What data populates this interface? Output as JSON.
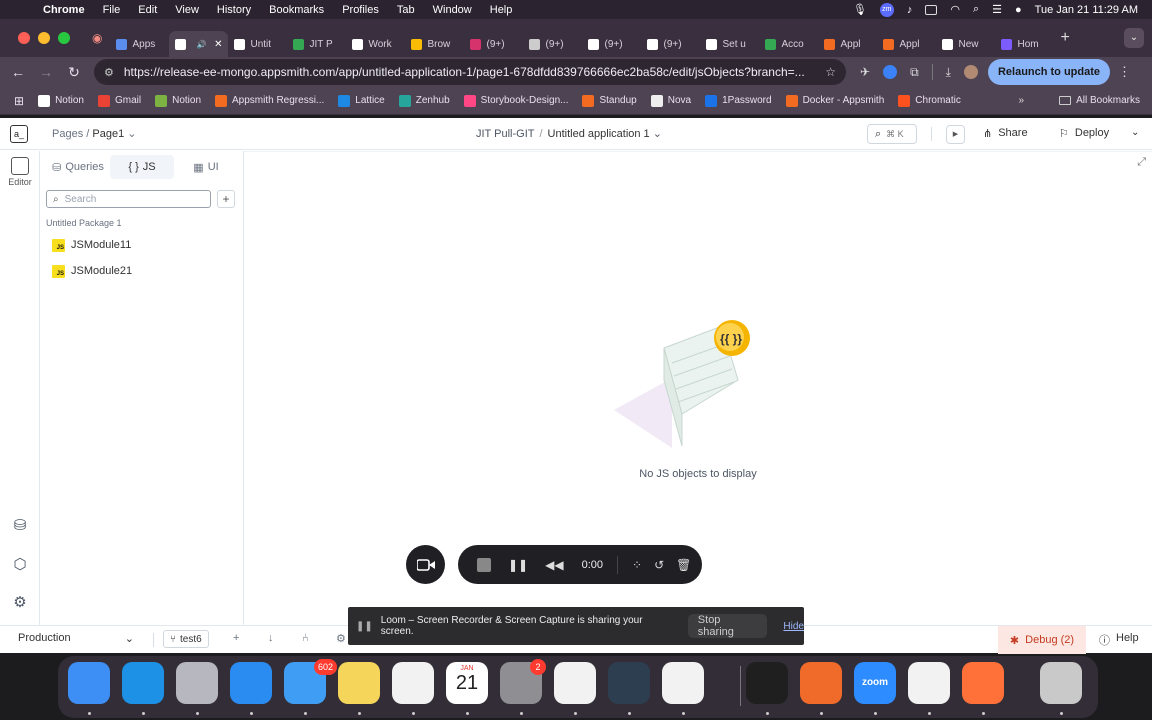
{
  "menubar": {
    "app": "Chrome",
    "items": [
      "File",
      "Edit",
      "View",
      "History",
      "Bookmarks",
      "Profiles",
      "Tab",
      "Window",
      "Help"
    ],
    "datetime": "Tue Jan 21  11:29 AM",
    "zm_label": "zm"
  },
  "tabs": [
    {
      "label": "Apps",
      "color": "#5b8def"
    },
    {
      "label": "",
      "color": "#ffffff",
      "active": true
    },
    {
      "label": "Untit",
      "color": "#ffffff"
    },
    {
      "label": "JIT P",
      "color": "#34a853"
    },
    {
      "label": "Work",
      "color": "#ffffff"
    },
    {
      "label": "Brow",
      "color": "#fbbc05"
    },
    {
      "label": "(9+)",
      "color": "#d6336c"
    },
    {
      "label": "(9+)",
      "color": "#cccccc"
    },
    {
      "label": "(9+)",
      "color": "#ffffff"
    },
    {
      "label": "(9+)",
      "color": "#ffffff"
    },
    {
      "label": "Set u",
      "color": "#ffffff"
    },
    {
      "label": "Acco",
      "color": "#34a853"
    },
    {
      "label": "Appl",
      "color": "#f36b21"
    },
    {
      "label": "Appl",
      "color": "#f36b21"
    },
    {
      "label": "New",
      "color": "#ffffff"
    },
    {
      "label": "Hom",
      "color": "#7c5cff"
    }
  ],
  "address": {
    "url": "https://release-ee-mongo.appsmith.com/app/untitled-application-1/page1-678dfdd839766666ec2ba58c/edit/jsObjects?branch=...",
    "relaunch": "Relaunch to update"
  },
  "bookmarks": [
    {
      "label": "Notion",
      "color": "#ffffff"
    },
    {
      "label": "Gmail",
      "color": "#ea4335"
    },
    {
      "label": "Notion",
      "color": "#7cb342"
    },
    {
      "label": "Appsmith Regressi...",
      "color": "#f36b21"
    },
    {
      "label": "Lattice",
      "color": "#1e88e5"
    },
    {
      "label": "Zenhub",
      "color": "#26a69a"
    },
    {
      "label": "Storybook-Design...",
      "color": "#ff4785"
    },
    {
      "label": "Standup",
      "color": "#f36b21"
    },
    {
      "label": "Nova",
      "color": "#eeeeee"
    },
    {
      "label": "1Password",
      "color": "#1a73e8"
    },
    {
      "label": "Docker - Appsmith",
      "color": "#f36b21"
    },
    {
      "label": "Chromatic",
      "color": "#fc521f"
    }
  ],
  "bookmarks_all": "All Bookmarks",
  "header": {
    "pages_label": "Pages",
    "page_name": "Page1",
    "branch_app": "JIT Pull-GIT",
    "app_name": "Untitled application 1",
    "search_shortcut": "⌘ K",
    "share": "Share",
    "deploy": "Deploy",
    "logo": "a_"
  },
  "rail": {
    "editor_label": "Editor"
  },
  "panel": {
    "tabs": [
      {
        "label": "Queries",
        "icon": "queries-icon"
      },
      {
        "label": "JS",
        "icon": "js-braces-icon",
        "active": true
      },
      {
        "label": "UI",
        "icon": "ui-widgets-icon"
      }
    ],
    "search_placeholder": "Search",
    "package": "Untitled Package 1",
    "modules": [
      "JSModule11",
      "JSModule21"
    ]
  },
  "canvas": {
    "empty_text": "No JS objects to display"
  },
  "footer": {
    "environment": "Production",
    "branch": "test6",
    "debug": "Debug (2)",
    "help": "Help"
  },
  "loom": {
    "time": "0:00",
    "banner": "Loom – Screen Recorder & Screen Capture is sharing your screen.",
    "stop_sharing": "Stop sharing",
    "hide": "Hide"
  },
  "dock": {
    "apps": [
      {
        "name": "Finder",
        "color": "#3d8ff5"
      },
      {
        "name": "Docker",
        "color": "#1d91e6"
      },
      {
        "name": "Launchpad",
        "color": "#b7b7c0"
      },
      {
        "name": "Safari",
        "color": "#2a8cf1"
      },
      {
        "name": "Mail",
        "color": "#3f9ef3",
        "badge": "602"
      },
      {
        "name": "Notes",
        "color": "#f6d65a"
      },
      {
        "name": "Freeform",
        "color": "#f2f2f2"
      },
      {
        "name": "Calendar",
        "color": "#ffffff"
      },
      {
        "name": "System Settings",
        "color": "#8e8e93",
        "badge": "2"
      },
      {
        "name": "Chrome",
        "color": "#f2f2f2"
      },
      {
        "name": "QuickTime",
        "color": "#2c3e50"
      },
      {
        "name": "Slack",
        "color": "#f2f2f2"
      },
      {
        "name": "Terminal",
        "color": "#1f1f1f"
      },
      {
        "name": "Pen",
        "color": "#f06a2a"
      },
      {
        "name": "Zoom",
        "color": "#2d8cff"
      },
      {
        "name": "VS Code",
        "color": "#f2f2f2"
      },
      {
        "name": "Firefox",
        "color": "#ff7139"
      },
      {
        "name": "Trash",
        "color": "#c9c9c9"
      }
    ],
    "calendar_month": "JAN",
    "calendar_day": "21",
    "zoom_label": "zoom"
  },
  "colors": {
    "accent": "#e15615",
    "js_badge": "#f7df1e",
    "debug_text": "#c43b22"
  }
}
